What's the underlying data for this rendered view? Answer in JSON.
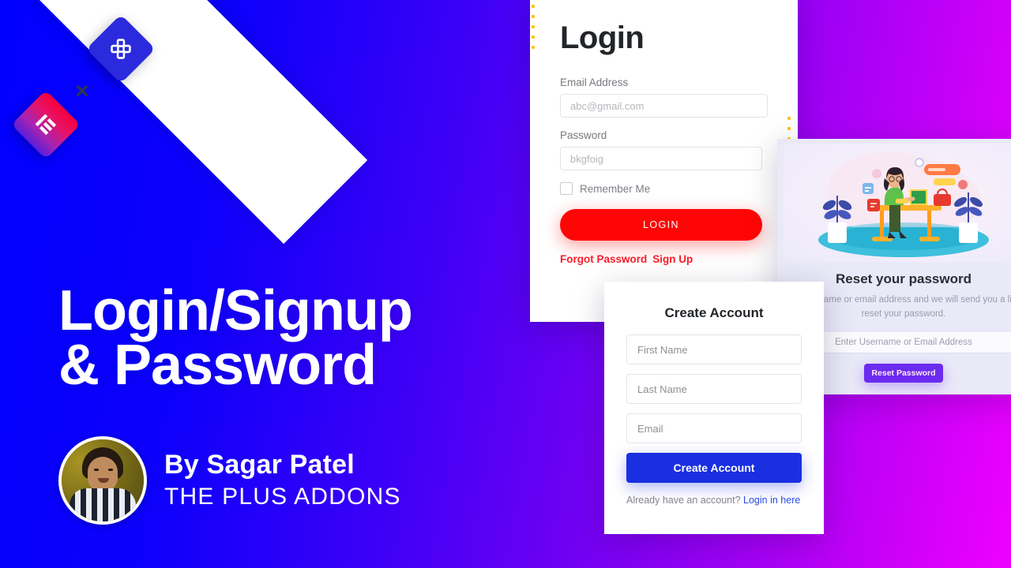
{
  "theme": {
    "bg_start": "#0000ff",
    "bg_end": "#ee00ff",
    "login_button_color": "#ff0505",
    "signup_button_color": "#1a2fe0",
    "reset_button_color": "#6c2bf0",
    "link_red": "#fb1d2a",
    "link_blue": "#2a4be8"
  },
  "branding": {
    "badge_plus_name": "the-plus-addons-logo",
    "badge_elementor_name": "elementor-logo",
    "x_symbol": "×"
  },
  "headline": {
    "line1": "Login/Signup",
    "line2": "& Password"
  },
  "author": {
    "by": "By Sagar Patel",
    "brand": "THE PLUS ADDONS"
  },
  "login_card": {
    "title": "Login",
    "email_label": "Email Address",
    "email_placeholder": "abc@gmail.com",
    "password_label": "Password",
    "password_placeholder": "bkgfoig",
    "remember_label": "Remember Me",
    "button_label": "LOGIN",
    "forgot_link": "Forgot Password",
    "signup_link": "Sign Up"
  },
  "signup_card": {
    "title": "Create Account",
    "first_name_placeholder": "First Name",
    "last_name_placeholder": "Last Name",
    "email_placeholder": "Email",
    "button_label": "Create Account",
    "foot_text": "Already have an account?",
    "foot_link": "Login in here"
  },
  "reset_card": {
    "title": "Reset your password",
    "description": "r username or email address and we will send you a li reset your password.",
    "input_placeholder": "Enter Username or Email Address",
    "button_label": "Reset Password",
    "illustration_name": "woman-at-desk-illustration"
  }
}
